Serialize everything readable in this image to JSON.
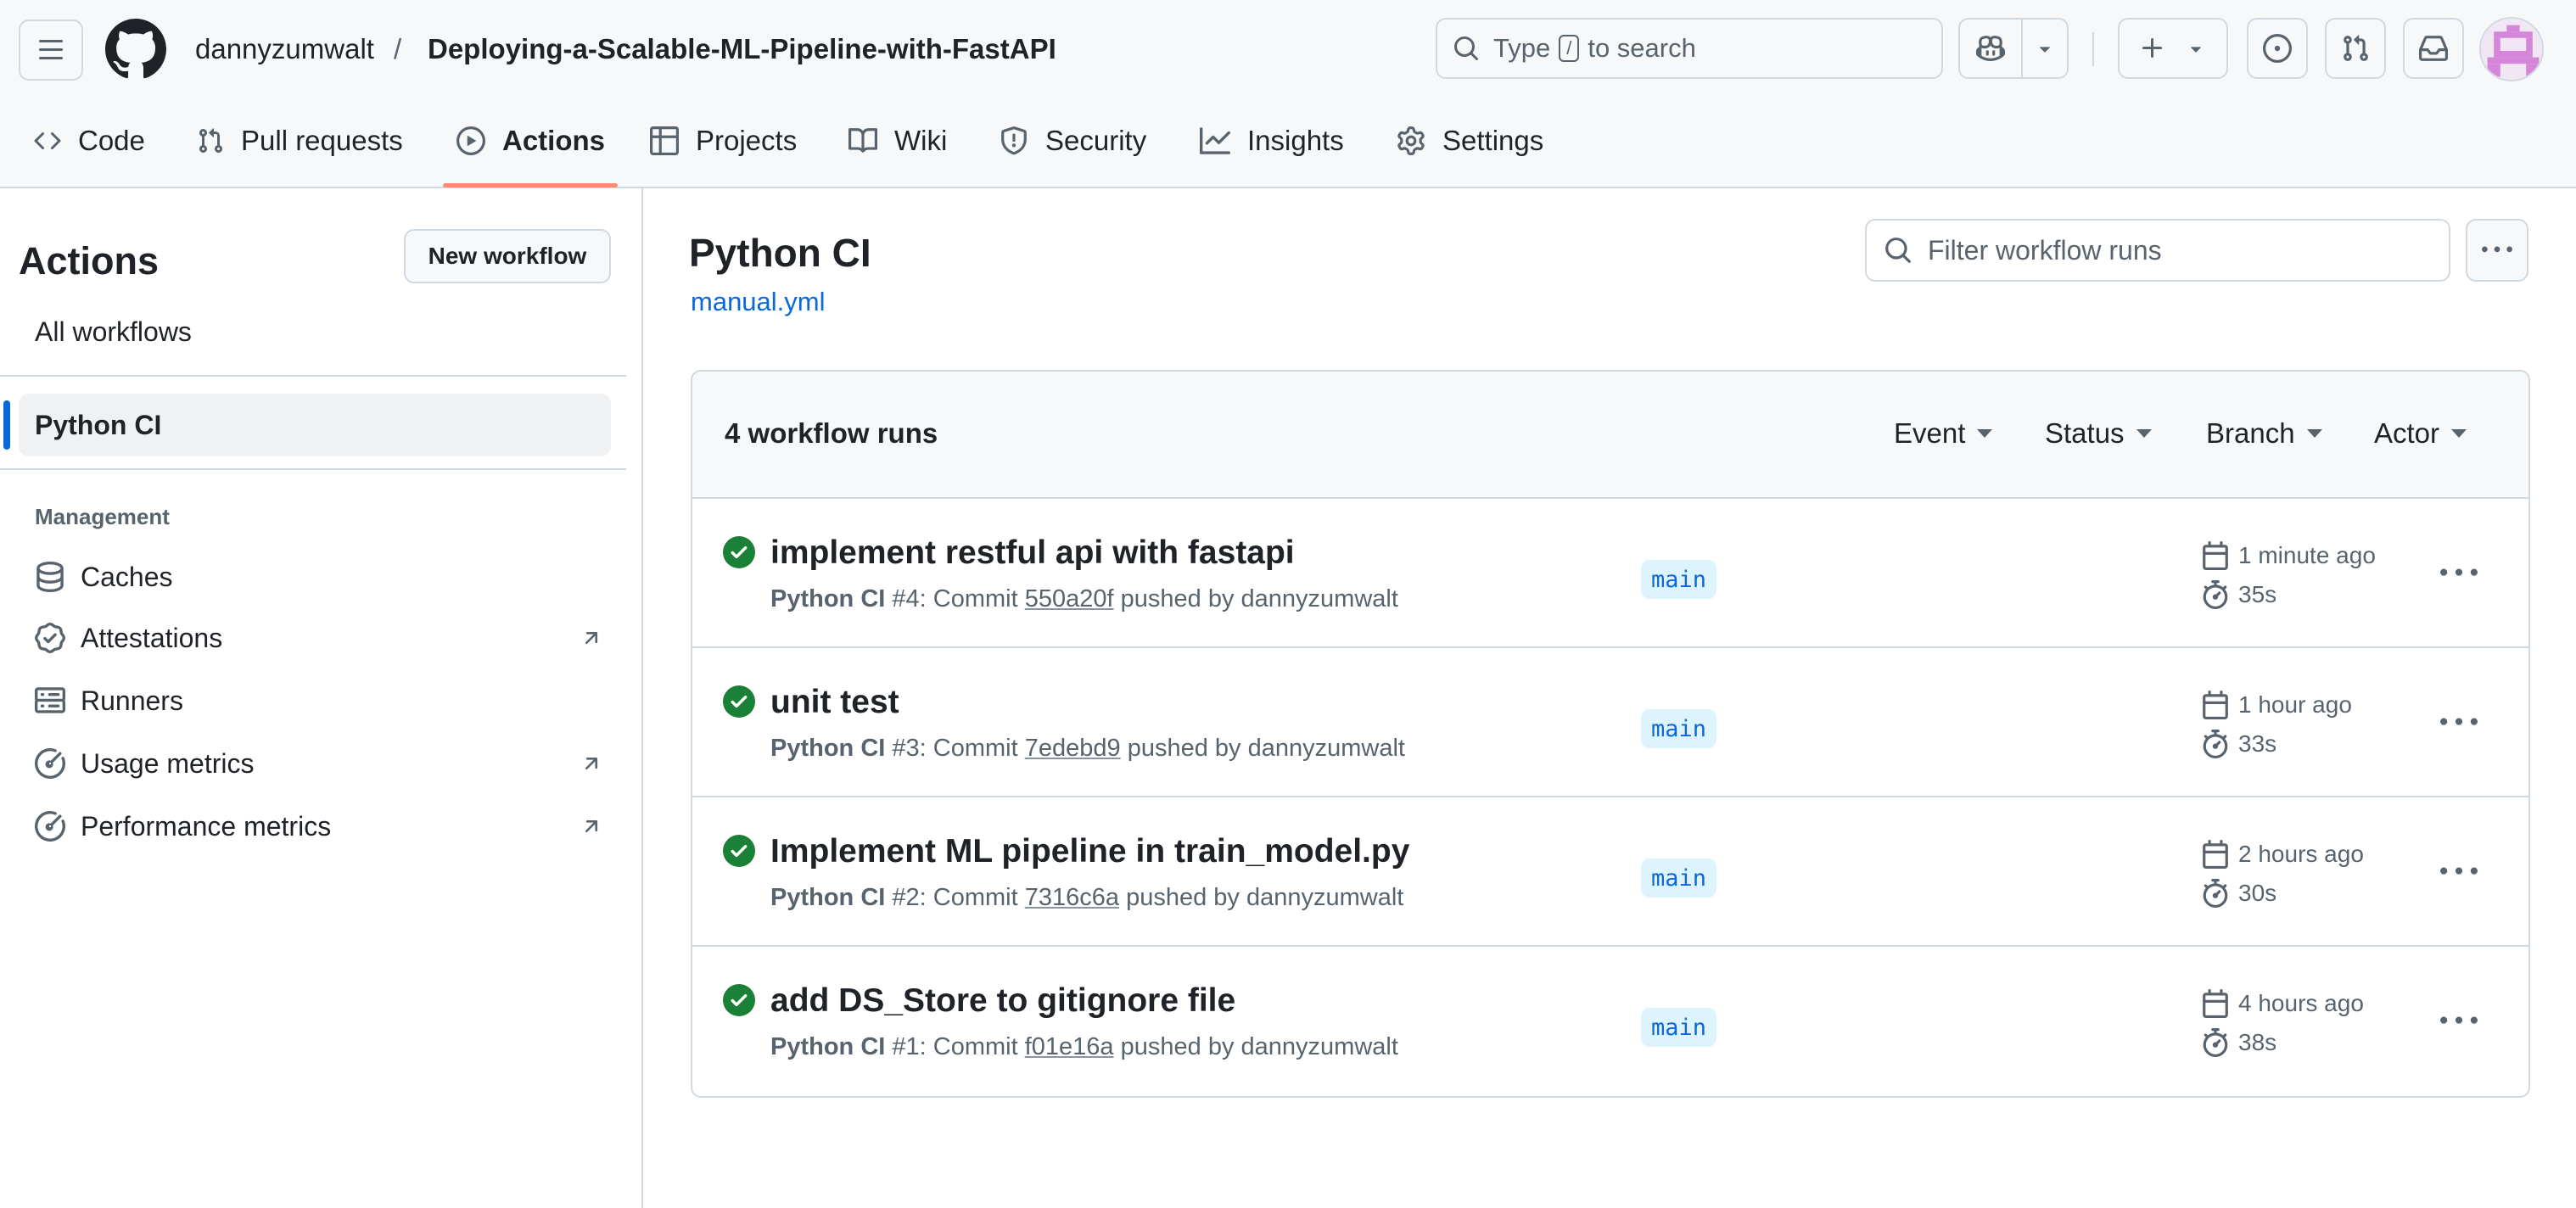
{
  "header": {
    "owner": "dannyzumwalt",
    "separator": "/",
    "repo": "Deploying-a-Scalable-ML-Pipeline-with-FastAPI",
    "search_prefix": "Type",
    "search_key": "/",
    "search_suffix": "to search"
  },
  "nav": {
    "code": "Code",
    "pull_requests": "Pull requests",
    "actions": "Actions",
    "projects": "Projects",
    "wiki": "Wiki",
    "security": "Security",
    "insights": "Insights",
    "settings": "Settings",
    "selected": "Actions",
    "underline_color": "#fd8c73"
  },
  "sidebar": {
    "title": "Actions",
    "new_workflow": "New workflow",
    "all_workflows": "All workflows",
    "selected_workflow": "Python CI",
    "management_heading": "Management",
    "items": [
      {
        "label": "Caches",
        "icon": "database-icon",
        "external": false
      },
      {
        "label": "Attestations",
        "icon": "verified-icon",
        "external": true
      },
      {
        "label": "Runners",
        "icon": "server-icon",
        "external": false
      },
      {
        "label": "Usage metrics",
        "icon": "meter-icon",
        "external": true
      },
      {
        "label": "Performance metrics",
        "icon": "meter-icon",
        "external": true
      }
    ]
  },
  "main": {
    "title": "Python CI",
    "file": "manual.yml",
    "filter_placeholder": "Filter workflow runs",
    "runs_count": "4 workflow runs",
    "filters": [
      "Event",
      "Status",
      "Branch",
      "Actor"
    ],
    "runs": [
      {
        "title": "implement restful api with fastapi",
        "workflow": "Python CI",
        "number": "#4",
        "sha": "550a20f",
        "author": "dannyzumwalt",
        "branch": "main",
        "when": "1 minute ago",
        "duration": "35s",
        "status": "success"
      },
      {
        "title": "unit test",
        "workflow": "Python CI",
        "number": "#3",
        "sha": "7edebd9",
        "author": "dannyzumwalt",
        "branch": "main",
        "when": "1 hour ago",
        "duration": "33s",
        "status": "success"
      },
      {
        "title": "Implement ML pipeline in train_model.py",
        "workflow": "Python CI",
        "number": "#2",
        "sha": "7316c6a",
        "author": "dannyzumwalt",
        "branch": "main",
        "when": "2 hours ago",
        "duration": "30s",
        "status": "success"
      },
      {
        "title": "add DS_Store to gitignore file",
        "workflow": "Python CI",
        "number": "#1",
        "sha": "f01e16a",
        "author": "dannyzumwalt",
        "branch": "main",
        "when": "4 hours ago",
        "duration": "38s",
        "status": "success"
      }
    ]
  },
  "colors": {
    "accent": "#0969da",
    "success": "#1a7f37",
    "border": "#d1d9e0",
    "muted": "#59636e"
  }
}
